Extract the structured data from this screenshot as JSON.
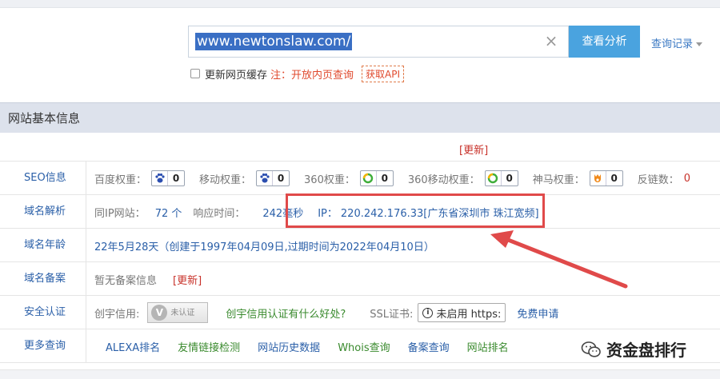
{
  "search": {
    "value": "www.newtonslaw.com/",
    "button_label": "查看分析",
    "history_label": "查询记录"
  },
  "cache": {
    "label": "更新网页缓存",
    "note": "注：开放内页查询",
    "api_label": "获取API"
  },
  "section": {
    "title": "网站基本信息",
    "update_label": "[更新]"
  },
  "seo": {
    "label": "SEO信息",
    "items": [
      {
        "name": "百度权重：",
        "value": "0",
        "icon": "paw-icon"
      },
      {
        "name": "移动权重：",
        "value": "0",
        "icon": "paw-icon"
      },
      {
        "name": "360权重：",
        "value": "0",
        "icon": "360-icon"
      },
      {
        "name": "360移动权重：",
        "value": "0",
        "icon": "360-icon"
      },
      {
        "name": "神马权重：",
        "value": "0",
        "icon": "shenma-icon"
      }
    ],
    "backlinks_label": "反链数：",
    "backlinks_value": "0"
  },
  "dns": {
    "label": "域名解析",
    "same_ip_label": "同IP网站：",
    "same_ip_value": "72 个",
    "response_label": "响应时间：",
    "response_value": "242毫秒",
    "ip_label": "IP：",
    "ip_value": "220.242.176.33[广东省深圳市 珠江宽频]"
  },
  "age": {
    "label": "域名年龄",
    "value": "22年5月28天（创建于1997年04月09日,过期时间为2022年04月10日）"
  },
  "icp": {
    "label": "域名备案",
    "value": "暂无备案信息",
    "update_label": "[更新]"
  },
  "security": {
    "label": "安全认证",
    "credit_label": "创宇信用:",
    "cert_text": "未认证",
    "cert_question": "创宇信用认证有什么好处?",
    "ssl_label": "SSL证书:",
    "ssl_value": "未启用 https:",
    "ssl_apply": "免费申请"
  },
  "more": {
    "label": "更多查询",
    "links": [
      "ALEXA排名",
      "友情链接检测",
      "网站历史数据",
      "Whois查询",
      "备案查询",
      "网站排名"
    ]
  },
  "watermark": {
    "text": "资金盘排行"
  },
  "colors": {
    "accent_blue": "#4aa3df",
    "link_blue": "#2a5fa8",
    "highlight_red": "#e04a4a"
  }
}
